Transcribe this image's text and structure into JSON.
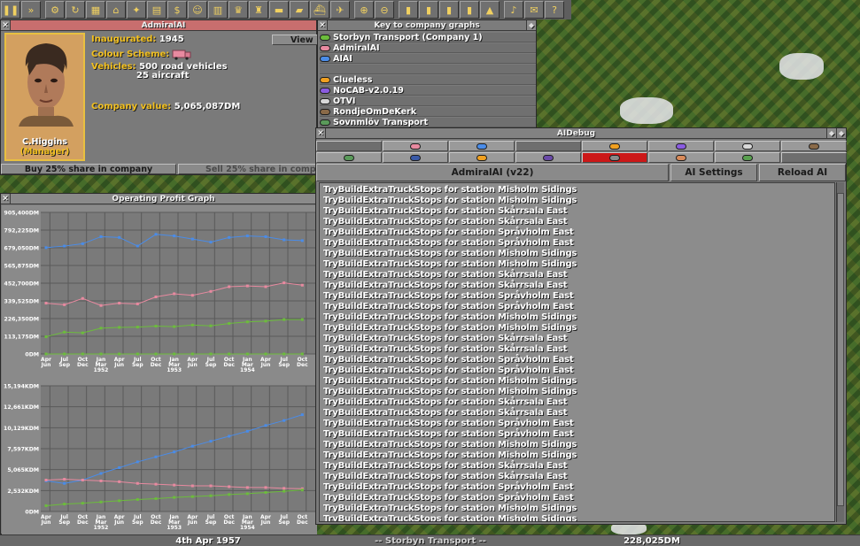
{
  "toolbar": {
    "buttons": [
      {
        "name": "pause-icon",
        "glyph": "❚❚"
      },
      {
        "name": "fast-forward-icon",
        "glyph": "»"
      },
      {
        "name": "settings-icon",
        "glyph": "⚙"
      },
      {
        "name": "save-icon",
        "glyph": "↻"
      },
      {
        "name": "map-icon",
        "glyph": "▦"
      },
      {
        "name": "town-directory-icon",
        "glyph": "⌂"
      },
      {
        "name": "subsidies-icon",
        "glyph": "✦"
      },
      {
        "name": "station-list-icon",
        "glyph": "▤"
      },
      {
        "name": "finances-icon",
        "glyph": "$"
      },
      {
        "name": "company-icon",
        "glyph": "☺"
      },
      {
        "name": "graphs-icon",
        "glyph": "▥"
      },
      {
        "name": "league-table-icon",
        "glyph": "♛"
      },
      {
        "name": "industry-icon",
        "glyph": "♜"
      },
      {
        "name": "train-list-icon",
        "glyph": "▬"
      },
      {
        "name": "road-vehicle-list-icon",
        "glyph": "▰"
      },
      {
        "name": "ship-list-icon",
        "glyph": "⛴"
      },
      {
        "name": "aircraft-list-icon",
        "glyph": "✈"
      },
      {
        "name": "zoom-in-icon",
        "glyph": "⊕"
      },
      {
        "name": "zoom-out-icon",
        "glyph": "⊖"
      },
      {
        "name": "build-rail-icon",
        "glyph": "▮"
      },
      {
        "name": "build-road-icon",
        "glyph": "▮"
      },
      {
        "name": "build-water-icon",
        "glyph": "▮"
      },
      {
        "name": "build-air-icon",
        "glyph": "▮"
      },
      {
        "name": "landscaping-icon",
        "glyph": "▲"
      },
      {
        "name": "music-icon",
        "glyph": "♪"
      },
      {
        "name": "messages-icon",
        "glyph": "✉"
      },
      {
        "name": "help-icon",
        "glyph": "?"
      }
    ]
  },
  "company": {
    "title": "AdmiralAI",
    "manager_name": "C.Higgins",
    "manager_role": "(Manager)",
    "inaugurated_label": "Inaugurated:",
    "inaugurated_value": "1945",
    "colour_label": "Colour Scheme:",
    "vehicles_label": "Vehicles:",
    "vehicles_road": "500 road vehicles",
    "vehicles_air": "25 aircraft",
    "value_label": "Company value:",
    "value_value": "5,065,087DM",
    "view_button": "View",
    "buy_share_button": "Buy 25% share in company",
    "sell_share_button": "Sell 25% share in company",
    "colour_hex": "#e88aa0"
  },
  "key": {
    "title": "Key to company graphs",
    "companies": [
      {
        "name": "Storbyn Transport (Company 1)",
        "color": "#6cbc3c"
      },
      {
        "name": "AdmiralAI",
        "color": "#e88aa0"
      },
      {
        "name": "AIAI",
        "color": "#4a8ce8"
      },
      {
        "name": "",
        "color": ""
      },
      {
        "name": "Clueless",
        "color": "#f0a020"
      },
      {
        "name": "NoCAB-v2.0.19",
        "color": "#8a5ce0"
      },
      {
        "name": "OTVI",
        "color": "#d8d8d8"
      },
      {
        "name": "RondjeOmDeKerk",
        "color": "#8a6a48"
      },
      {
        "name": "Sovnmlöv Transport",
        "color": "#5a9a5a"
      }
    ]
  },
  "graph": {
    "title": "Operating Profit Graph"
  },
  "chart_data": [
    {
      "type": "line",
      "y_tick_labels": [
        "905,400DM",
        "792,225DM",
        "679,050DM",
        "565,875DM",
        "452,700DM",
        "339,525DM",
        "226,350DM",
        "113,175DM",
        "0DM"
      ],
      "ylim": [
        0,
        905400
      ],
      "x_tick_labels": [
        {
          "top": "Apr",
          "bottom": "Jun",
          "year": ""
        },
        {
          "top": "Jul",
          "bottom": "Sep",
          "year": ""
        },
        {
          "top": "Oct",
          "bottom": "Dec",
          "year": ""
        },
        {
          "top": "Jan",
          "bottom": "Mar",
          "year": "1952"
        },
        {
          "top": "Apr",
          "bottom": "Jun",
          "year": ""
        },
        {
          "top": "Jul",
          "bottom": "Sep",
          "year": ""
        },
        {
          "top": "Oct",
          "bottom": "Dec",
          "year": ""
        },
        {
          "top": "Jan",
          "bottom": "Mar",
          "year": "1953"
        },
        {
          "top": "Apr",
          "bottom": "Jun",
          "year": ""
        },
        {
          "top": "Jul",
          "bottom": "Sep",
          "year": ""
        },
        {
          "top": "Oct",
          "bottom": "Dec",
          "year": ""
        },
        {
          "top": "Jan",
          "bottom": "Mar",
          "year": "1954"
        },
        {
          "top": "Apr",
          "bottom": "Jun",
          "year": ""
        },
        {
          "top": "Jul",
          "bottom": "Sep",
          "year": ""
        },
        {
          "top": "Oct",
          "bottom": "Dec",
          "year": ""
        }
      ],
      "series": [
        {
          "color": "#4a8ce8",
          "values": [
            680000,
            690000,
            705000,
            750000,
            745000,
            690000,
            765000,
            755000,
            735000,
            715000,
            745000,
            755000,
            750000,
            730000,
            725000
          ]
        },
        {
          "color": "#e88aa0",
          "values": [
            325000,
            315000,
            355000,
            310000,
            325000,
            320000,
            365000,
            385000,
            375000,
            400000,
            430000,
            435000,
            430000,
            455000,
            440000
          ]
        },
        {
          "color": "#6cbc3c",
          "values": [
            110000,
            140000,
            135000,
            165000,
            170000,
            172000,
            178000,
            175000,
            185000,
            180000,
            195000,
            205000,
            210000,
            220000,
            220000
          ]
        },
        {
          "color": "#6cbc3c",
          "values": [
            0,
            0,
            0,
            0,
            0,
            0,
            0,
            0,
            0,
            0,
            0,
            0,
            0,
            0,
            0
          ]
        }
      ]
    },
    {
      "type": "line",
      "y_tick_labels": [
        "15,194KDM",
        "12,661KDM",
        "10,129KDM",
        "7,597KDM",
        "5,065KDM",
        "2,532KDM",
        "0DM"
      ],
      "ylim": [
        0,
        15194000
      ],
      "x_tick_labels": [
        {
          "top": "Apr",
          "bottom": "Jun",
          "year": ""
        },
        {
          "top": "Jul",
          "bottom": "Sep",
          "year": ""
        },
        {
          "top": "Oct",
          "bottom": "Dec",
          "year": ""
        },
        {
          "top": "Jan",
          "bottom": "Mar",
          "year": "1952"
        },
        {
          "top": "Apr",
          "bottom": "Jun",
          "year": ""
        },
        {
          "top": "Jul",
          "bottom": "Sep",
          "year": ""
        },
        {
          "top": "Oct",
          "bottom": "Dec",
          "year": ""
        },
        {
          "top": "Jan",
          "bottom": "Mar",
          "year": "1953"
        },
        {
          "top": "Apr",
          "bottom": "Jun",
          "year": ""
        },
        {
          "top": "Jul",
          "bottom": "Sep",
          "year": ""
        },
        {
          "top": "Oct",
          "bottom": "Dec",
          "year": ""
        },
        {
          "top": "Jan",
          "bottom": "Mar",
          "year": "1954"
        },
        {
          "top": "Apr",
          "bottom": "Jun",
          "year": ""
        },
        {
          "top": "Jul",
          "bottom": "Sep",
          "year": ""
        },
        {
          "top": "Oct",
          "bottom": "Dec",
          "year": ""
        }
      ],
      "series": [
        {
          "color": "#4a8ce8",
          "values": [
            3700000,
            3400000,
            3800000,
            4600000,
            5300000,
            6000000,
            6600000,
            7200000,
            7900000,
            8500000,
            9100000,
            9700000,
            10400000,
            11000000,
            11700000
          ]
        },
        {
          "color": "#e88aa0",
          "values": [
            3800000,
            3900000,
            3800000,
            3700000,
            3600000,
            3400000,
            3300000,
            3200000,
            3100000,
            3100000,
            3000000,
            2900000,
            2900000,
            2800000,
            2750000
          ]
        },
        {
          "color": "#6cbc3c",
          "values": [
            700000,
            900000,
            1000000,
            1150000,
            1300000,
            1450000,
            1550000,
            1700000,
            1800000,
            1900000,
            2050000,
            2150000,
            2300000,
            2450000,
            2600000
          ]
        }
      ]
    }
  ],
  "aidebug": {
    "title": "AIDebug",
    "ai_name": "AdmiralAI (v22)",
    "settings_button": "AI Settings",
    "reload_button": "Reload AI",
    "company_buttons_row1": [
      {
        "color": "",
        "state": "off"
      },
      {
        "color": "#e88aa0",
        "state": "on"
      },
      {
        "color": "#4a8ce8",
        "state": "on"
      },
      {
        "color": "",
        "state": "off"
      },
      {
        "color": "#f0a020",
        "state": "on"
      },
      {
        "color": "#8a5ce0",
        "state": "on"
      },
      {
        "color": "#d8d8d8",
        "state": "on"
      },
      {
        "color": "#8a6a48",
        "state": "on"
      }
    ],
    "company_buttons_row2": [
      {
        "color": "#5a9a5a",
        "state": "on"
      },
      {
        "color": "#3a5aa8",
        "state": "on"
      },
      {
        "color": "#f0a020",
        "state": "on"
      },
      {
        "color": "#6a4aa8",
        "state": "on"
      },
      {
        "color": "#8a8a8a",
        "state": "selected"
      },
      {
        "color": "#d88a5a",
        "state": "on"
      },
      {
        "color": "#5aa050",
        "state": "on"
      },
      {
        "color": "",
        "state": "off"
      }
    ],
    "log_lines": [
      "TryBuildExtraTruckStops for station Misholm Sidings",
      "TryBuildExtraTruckStops for station Misholm Sidings",
      "TryBuildExtraTruckStops for station Skårrsala East",
      "TryBuildExtraTruckStops for station Skårrsala East",
      "TryBuildExtraTruckStops for station Språvholm East",
      "TryBuildExtraTruckStops for station Språvholm East",
      "TryBuildExtraTruckStops for station Misholm Sidings",
      "TryBuildExtraTruckStops for station Misholm Sidings",
      "TryBuildExtraTruckStops for station Skårrsala East",
      "TryBuildExtraTruckStops for station Skårrsala East",
      "TryBuildExtraTruckStops for station Språvholm East",
      "TryBuildExtraTruckStops for station Språvholm East",
      "TryBuildExtraTruckStops for station Misholm Sidings",
      "TryBuildExtraTruckStops for station Misholm Sidings",
      "TryBuildExtraTruckStops for station Skårrsala East",
      "TryBuildExtraTruckStops for station Skårrsala East",
      "TryBuildExtraTruckStops for station Språvholm East",
      "TryBuildExtraTruckStops for station Språvholm East",
      "TryBuildExtraTruckStops for station Misholm Sidings",
      "TryBuildExtraTruckStops for station Misholm Sidings",
      "TryBuildExtraTruckStops for station Skårrsala East",
      "TryBuildExtraTruckStops for station Skårrsala East",
      "TryBuildExtraTruckStops for station Språvholm East",
      "TryBuildExtraTruckStops for station Språvholm East",
      "TryBuildExtraTruckStops for station Misholm Sidings",
      "TryBuildExtraTruckStops for station Misholm Sidings",
      "TryBuildExtraTruckStops for station Skårrsala East",
      "TryBuildExtraTruckStops for station Skårrsala East",
      "TryBuildExtraTruckStops for station Språvholm East",
      "TryBuildExtraTruckStops for station Språvholm East",
      "TryBuildExtraTruckStops for station Misholm Sidings",
      "TryBuildExtraTruckStops for station Misholm Sidings"
    ]
  },
  "status": {
    "date": "4th Apr 1957",
    "company": "-- Storbyn Transport --",
    "money": "228,025DM"
  }
}
